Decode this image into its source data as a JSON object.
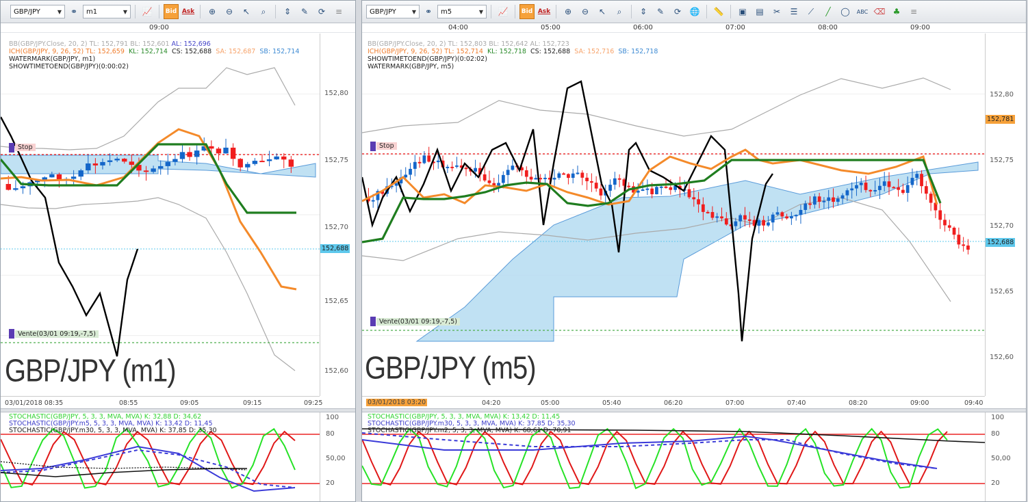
{
  "left": {
    "symbol": "GBP/JPY",
    "timeframe": "m1",
    "bid_label": "Bid",
    "ask_label": "Ask",
    "top_ticks": [
      "09:00"
    ],
    "legend": [
      {
        "t": "BB(GBP/JPY.Close, 20, 2)  TL: 152,791  BL: 152,601  ",
        "c": "#aaaaaa",
        "extra": "AL: 152,696",
        "ec": "#4747c9"
      },
      {
        "t": "ICH(GBP/JPY, 9, 26, 52)  TL: 152,659",
        "c": "#f07d2c",
        "extra": "KL: 152,714",
        "ec": "#2a8b2a",
        "extra2": "CS: 152,688",
        "e2c": "#222",
        "extra3": "SA: 152,687",
        "e3c": "#f7a36a",
        "extra4": "SB: 152,714",
        "e4c": "#3d8ad3"
      },
      {
        "t": "WATERMARK(GBP/JPY, m1)",
        "c": "#222"
      },
      {
        "t": "SHOWTIMETOEND(GBP/JPY)(0:00:02)",
        "c": "#222"
      }
    ],
    "yticks": [
      "152,80",
      "152,75",
      "152,70",
      "152,65",
      "152,60"
    ],
    "price_box": "152,688",
    "stop_label": "Stop",
    "vente_label": "Vente(03/01 09:19,-7,5)",
    "watermark": "GBP/JPY (m1)",
    "xticks": [
      "03/01/2018 08:35",
      "08:55",
      "09:05",
      "09:15",
      "09:25"
    ],
    "osc_legend": [
      {
        "t": "STOCHASTIC(GBP/JPY, 5, 3, 3, MVA, MVA)   K: 32,88   D: 34,62",
        "c": "#32d232"
      },
      {
        "t": "STOCHASTIC(GBP/JPY.m5, 5, 3, 3, MVA, MVA)   K: 13,42   D: 11,45",
        "c": "#3d3dc9"
      },
      {
        "t": "STOCHASTIC(GBP/JPY.m30, 5, 3, 3, MVA, MVA)   K: 37,85   D: 35,30",
        "c": "#222"
      }
    ],
    "osc_ticks": [
      "100",
      "80",
      "50,00",
      "20"
    ]
  },
  "right": {
    "symbol": "GBP/JPY",
    "timeframe": "m5",
    "bid_label": "Bid",
    "ask_label": "Ask",
    "top_ticks": [
      "04:00",
      "05:00",
      "06:00",
      "07:00",
      "08:00",
      "09:00"
    ],
    "legend": [
      {
        "t": "BB(GBP/JPY.Close, 20, 2)  TL: 152,803  BL: 152,642  AL: 152,723",
        "c": "#aaaaaa"
      },
      {
        "t": "ICH(GBP/JPY, 9, 26, 52)  TL: 152,714",
        "c": "#f07d2c",
        "extra": "KL: 152,718",
        "ec": "#2a8b2a",
        "extra2": "CS: 152,688",
        "e2c": "#222",
        "extra3": "SA: 152,716",
        "e3c": "#f7a36a",
        "extra4": "SB: 152,718",
        "e4c": "#3d8ad3"
      },
      {
        "t": "SHOWTIMETOEND(GBP/JPY)(0:02:02)",
        "c": "#222"
      },
      {
        "t": "WATERMARK(GBP/JPY, m5)",
        "c": "#222"
      }
    ],
    "yticks": [
      "152,80",
      "152,75",
      "152,70",
      "152,65",
      "152,60"
    ],
    "price_box": "152,688",
    "price_box2": "152,781",
    "stop_label": "Stop",
    "vente_label": "Vente(03/01 09:19,-7,5)",
    "watermark": "GBP/JPY (m5)",
    "first_date": "03/01/2018 03:20",
    "xticks": [
      "04:20",
      "05:00",
      "05:40",
      "06:20",
      "07:00",
      "07:40",
      "08:20",
      "09:00",
      "09:40"
    ],
    "osc_legend": [
      {
        "t": "STOCHASTIC(GBP/JPY, 5, 3, 3, MVA, MVA)   K: 13,42   D: 11,45",
        "c": "#32d232"
      },
      {
        "t": "STOCHASTIC(GBP/JPY.m30, 5, 3, 3, MVA, MVA)   K: 37,85   D: 35,30",
        "c": "#3d3dc9"
      },
      {
        "t": "STOCHASTIC(GBP/JPY.m2, 5, 3, 3, MVA, MVA)   K: 68,61   D: 70,91",
        "c": "#222"
      }
    ],
    "osc_ticks": [
      "100",
      "80",
      "50,00",
      "20"
    ]
  }
}
